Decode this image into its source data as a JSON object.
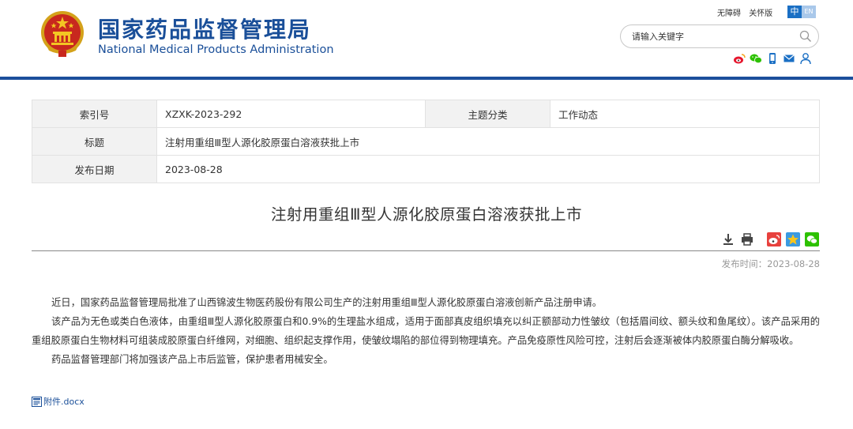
{
  "header": {
    "title_cn": "国家药品监督管理局",
    "title_en": "National Medical Products Administration",
    "accessibility_link": "无障碍",
    "care_version_link": "关怀版",
    "lang_zh": "中",
    "lang_en": "EN",
    "search_placeholder": "请输入关键字",
    "brand_color": "#1a4f99"
  },
  "info": {
    "index_label": "索引号",
    "index_value": "XZXK-2023-292",
    "category_label": "主题分类",
    "category_value": "工作动态",
    "title_label": "标题",
    "title_value": "注射用重组Ⅲ型人源化胶原蛋白溶液获批上市",
    "date_label": "发布日期",
    "date_value": "2023-08-28"
  },
  "article": {
    "title": "注射用重组Ⅲ型人源化胶原蛋白溶液获批上市",
    "publish_time": "发布时间：2023-08-28",
    "paragraphs": [
      "近日，国家药品监督管理局批准了山西锦波生物医药股份有限公司生产的注射用重组Ⅲ型人源化胶原蛋白溶液创新产品注册申请。",
      "该产品为无色或类白色液体，由重组Ⅲ型人源化胶原蛋白和0.9%的生理盐水组成，适用于面部真皮组织填充以纠正额部动力性皱纹（包括眉间纹、额头纹和鱼尾纹）。该产品采用的重组胶原蛋白生物材料可组装成胶原蛋白纤维网，对细胞、组织起支撑作用，使皱纹塌陷的部位得到物理填充。产品免疫原性风险可控，注射后会逐渐被体内胶原蛋白酶分解吸收。",
      "药品监督管理部门将加强该产品上市后监管，保护患者用械安全。"
    ],
    "attachment": "附件.docx"
  },
  "icons": {
    "header": [
      "national-emblem-icon",
      "search-icon",
      "weibo-icon",
      "wechat-icon",
      "mobile-icon",
      "mail-icon",
      "user-icon"
    ],
    "tools": [
      "download-icon",
      "print-icon",
      "weibo-share-icon",
      "qzone-share-icon",
      "wechat-share-icon"
    ],
    "attachment": "doc-file-icon"
  }
}
